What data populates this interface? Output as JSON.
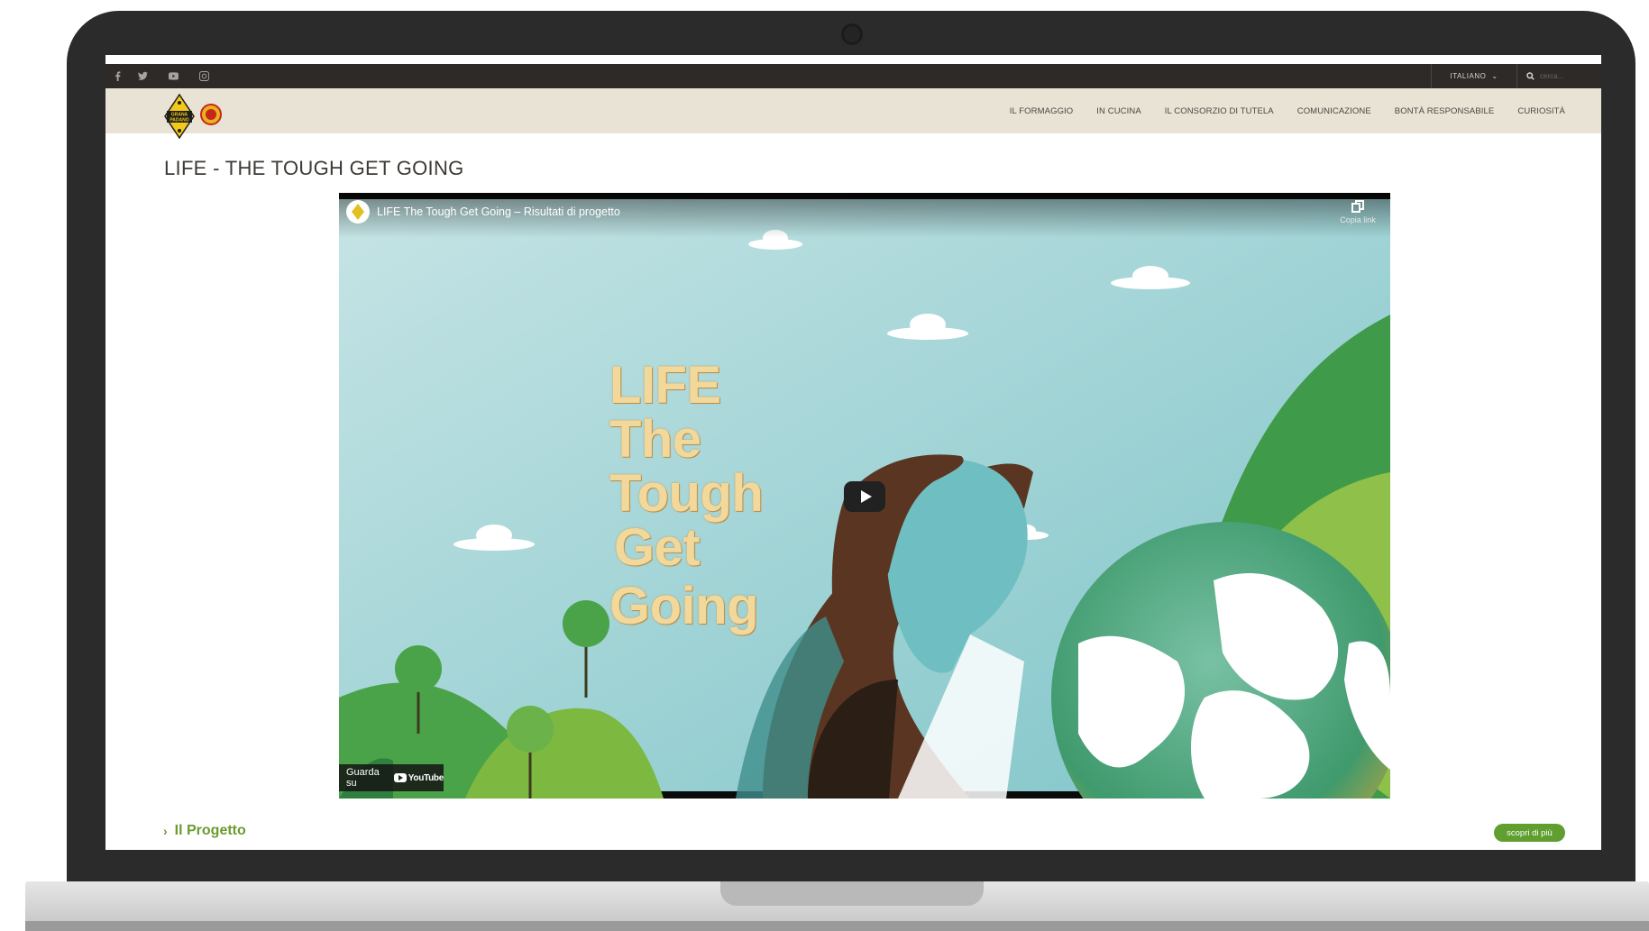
{
  "topbar": {
    "social_icons": [
      "facebook-icon",
      "twitter-icon",
      "youtube-icon",
      "instagram-icon"
    ],
    "language": "ITALIANO",
    "search_placeholder": "cerca..."
  },
  "nav": {
    "items": [
      "IL FORMAGGIO",
      "IN CUCINA",
      "IL CONSORZIO DI TUTELA",
      "COMUNICAZIONE",
      "BONTÀ RESPONSABILE",
      "CURIOSITÀ"
    ]
  },
  "logo": {
    "text_lines": [
      "GRANA",
      "PADANO"
    ]
  },
  "page": {
    "title": "LIFE - THE TOUGH GET GOING"
  },
  "video": {
    "title": "LIFE The Tough Get Going – Risultati di progetto",
    "copy_label": "Copia link",
    "watch_label": "Guarda su",
    "youtube_label": "YouTube",
    "overlay_lines": [
      "LIFE",
      "The",
      "Tough",
      "Get",
      "Going"
    ]
  },
  "section": {
    "label": "Il Progetto",
    "button": "scopri di più"
  },
  "colors": {
    "topbar": "#2e2a27",
    "navbar": "#e9e3d6",
    "accent_green": "#5f9e2f",
    "laptop_bezel": "#2b2b2b"
  }
}
